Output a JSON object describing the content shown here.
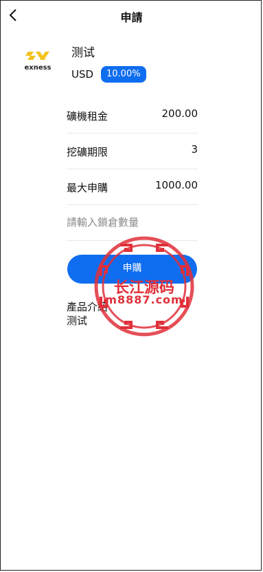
{
  "header": {
    "title": "申請",
    "back_icon": "chevron-left-icon"
  },
  "product": {
    "logo_text": "exness",
    "logo_icon": "exness-logo",
    "name": "测试",
    "currency": "USD",
    "rate": "10.00%"
  },
  "details": [
    {
      "label": "礦機租金",
      "value": "200.00"
    },
    {
      "label": "挖礦期限",
      "value": "3"
    },
    {
      "label": "最大申購",
      "value": "1000.00"
    }
  ],
  "amount_input": {
    "placeholder": "請輸入鎖倉數量",
    "value": ""
  },
  "buy_button": {
    "label": "申購"
  },
  "description": {
    "label": "產品介紹",
    "text": "测试"
  },
  "watermark": {
    "line1": "长江源码",
    "line2": "m8887.com"
  },
  "colors": {
    "accent": "#0f6df0",
    "watermark": "#e0303a",
    "logo_yellow": "#f2c31b"
  }
}
